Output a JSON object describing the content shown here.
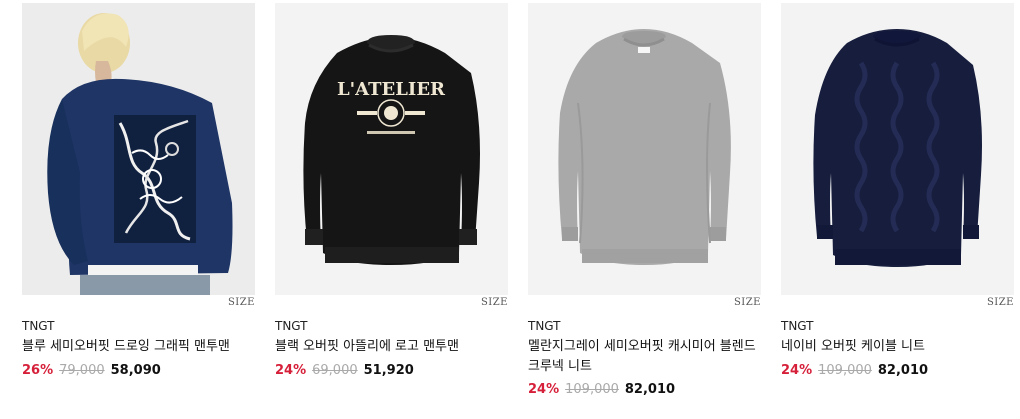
{
  "products": [
    {
      "brand": "TNGT",
      "name": "블루 세미오버핏 드로잉 그래픽 맨투맨",
      "size_label": "SIZE",
      "discount": "26%",
      "original_price": "79,000",
      "sale_price": "58,090",
      "image_icon": "navy-graphic-sweatshirt-photo",
      "colors": {
        "garment": "#1e3566",
        "background": "#eeeeee"
      }
    },
    {
      "brand": "TNGT",
      "name": "블랙 오버핏 아뜰리에 로고 맨투맨",
      "size_label": "SIZE",
      "discount": "24%",
      "original_price": "69,000",
      "sale_price": "51,920",
      "image_icon": "black-logo-sweatshirt-photo",
      "print_text": "L'ATELIER",
      "colors": {
        "garment": "#141414",
        "background": "#f3f3f3"
      }
    },
    {
      "brand": "TNGT",
      "name": "멜란지그레이 세미오버핏 캐시미어 블렌드 크루넥 니트",
      "size_label": "SIZE",
      "discount": "24%",
      "original_price": "109,000",
      "sale_price": "82,010",
      "image_icon": "grey-crewneck-knit-photo",
      "colors": {
        "garment": "#a9a9a9",
        "background": "#f3f3f3"
      }
    },
    {
      "brand": "TNGT",
      "name": "네이비 오버핏 케이블 니트",
      "size_label": "SIZE",
      "discount": "24%",
      "original_price": "109,000",
      "sale_price": "82,010",
      "image_icon": "navy-cable-knit-photo",
      "colors": {
        "garment": "#161d3d",
        "background": "#f3f3f3"
      }
    }
  ],
  "theme": {
    "discount_color": "#d6203a",
    "strike_color": "#aaaaaa"
  }
}
